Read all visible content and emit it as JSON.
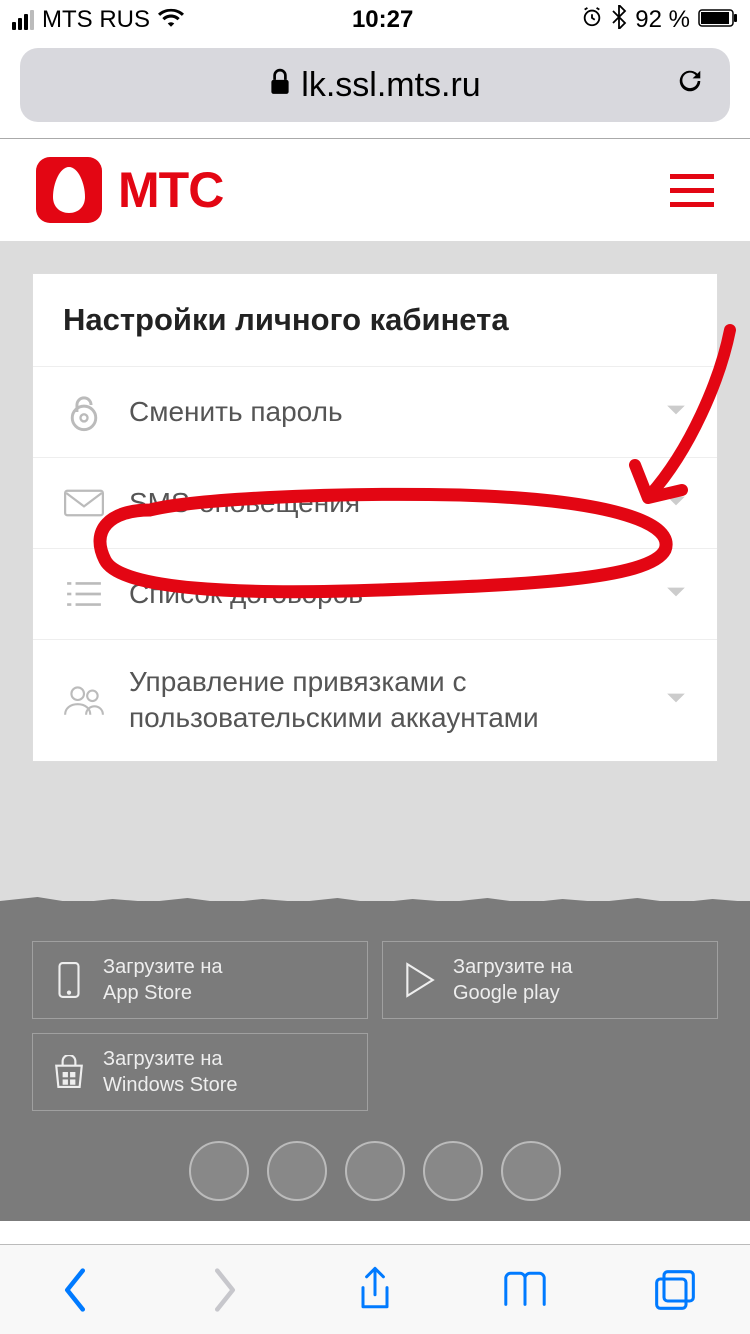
{
  "status": {
    "carrier": "MTS RUS",
    "time": "10:27",
    "battery": "92 %"
  },
  "address": {
    "url": "lk.ssl.mts.ru"
  },
  "header": {
    "brand": "МТС"
  },
  "settings": {
    "title": "Настройки личного кабинета",
    "items": [
      {
        "label": "Сменить пароль"
      },
      {
        "label": "SMS-оповещения"
      },
      {
        "label": "Список договоров"
      },
      {
        "label": "Управление привязками с пользовательскими аккаунтами"
      }
    ]
  },
  "stores": {
    "appstore": {
      "line1": "Загрузите на",
      "line2": "App Store"
    },
    "google": {
      "line1": "Загрузите на",
      "line2": "Google play"
    },
    "windows": {
      "line1": "Загрузите на",
      "line2": "Windows Store"
    }
  }
}
